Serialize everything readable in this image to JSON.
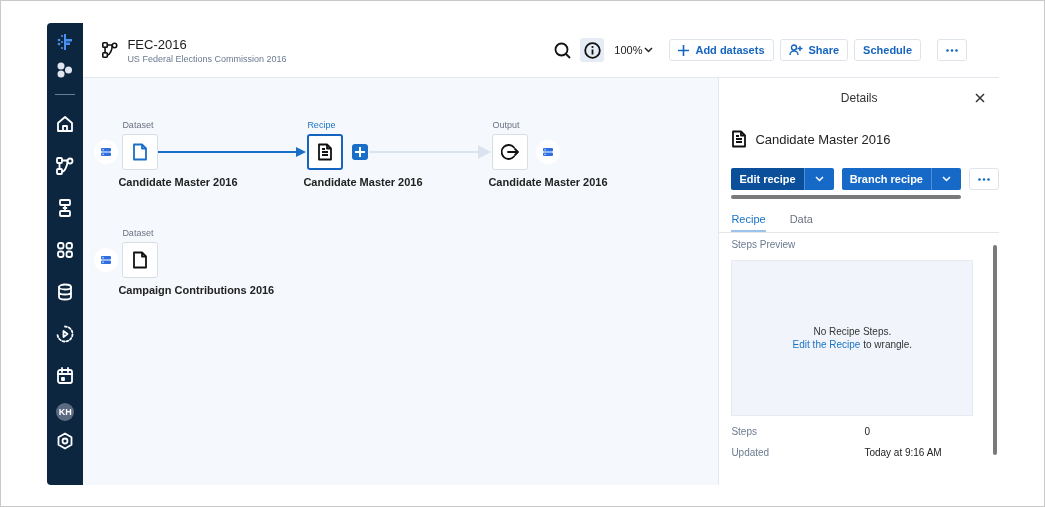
{
  "sidebar": {
    "avatar": "KH"
  },
  "header": {
    "title": "FEC-2016",
    "subtitle": "US Federal Elections Commission 2016",
    "info_selected": true,
    "zoom": "100%",
    "buttons": [
      {
        "kind": "add",
        "label": "Add datasets"
      },
      {
        "kind": "share",
        "label": "Share"
      },
      {
        "kind": "plain",
        "label": "Schedule"
      },
      {
        "kind": "more"
      }
    ]
  },
  "canvas": {
    "rows": [
      [
        {
          "kind": "dataset",
          "type_label": "Dataset",
          "name": "Candidate Master 2016",
          "selected": false
        },
        {
          "kind": "recipe",
          "type_label": "Recipe",
          "name": "Candidate Master 2016",
          "selected": true
        },
        {
          "kind": "output",
          "type_label": "Output",
          "name": "Candidate Master 2016",
          "selected": false
        }
      ],
      [
        {
          "kind": "dataset",
          "type_label": "Dataset",
          "name": "Campaign Contributions 2016",
          "selected": false
        }
      ]
    ],
    "edges": [
      {
        "active": true
      },
      {
        "active": false
      }
    ]
  },
  "details": {
    "title": "Details",
    "heading": "Candidate Master 2016",
    "actions": [
      {
        "label": "Edit recipe",
        "pressed": true
      },
      {
        "label": "Branch recipe",
        "pressed": false
      }
    ],
    "tabs": [
      {
        "label": "Recipe",
        "selected": true
      },
      {
        "label": "Data",
        "selected": false
      }
    ],
    "preview_label": "Steps Preview",
    "empty_title": "No Recipe Steps.",
    "empty_link": "Edit the Recipe",
    "empty_rest": "to wrangle.",
    "properties": [
      {
        "label": "Steps",
        "value": "0"
      },
      {
        "label": "Updated",
        "value": "Today at 9:16 AM"
      }
    ]
  }
}
